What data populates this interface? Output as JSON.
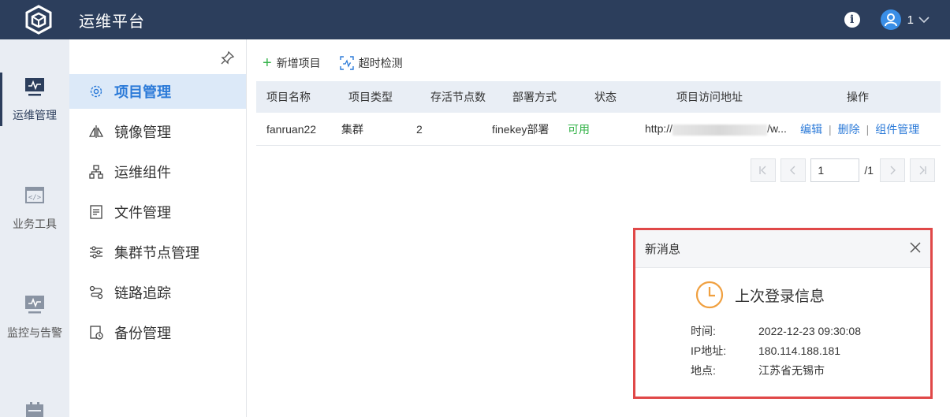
{
  "app": {
    "title": "运维平台",
    "user": "1"
  },
  "rail": [
    {
      "label": "运维管理",
      "icon": "monitor-chart-icon"
    },
    {
      "label": "业务工具",
      "icon": "code-window-icon"
    },
    {
      "label": "监控与告警",
      "icon": "monitor-alert-icon"
    },
    {
      "label": "",
      "icon": "calendar-icon"
    }
  ],
  "subnav": [
    {
      "label": "项目管理",
      "icon": "gear-icon"
    },
    {
      "label": "镜像管理",
      "icon": "mirror-icon"
    },
    {
      "label": "运维组件",
      "icon": "org-chart-icon"
    },
    {
      "label": "文件管理",
      "icon": "file-icon"
    },
    {
      "label": "集群节点管理",
      "icon": "sliders-icon"
    },
    {
      "label": "链路追踪",
      "icon": "trace-icon"
    },
    {
      "label": "备份管理",
      "icon": "backup-icon"
    }
  ],
  "toolbar": {
    "add_label": "新增项目",
    "timeout_label": "超时检测"
  },
  "table": {
    "headers": [
      "项目名称",
      "项目类型",
      "存活节点数",
      "部署方式",
      "状态",
      "项目访问地址",
      "操作"
    ],
    "rows": [
      {
        "name": "fanruan22",
        "type": "集群",
        "alive": "2",
        "deploy": "finekey部署",
        "status": "可用",
        "url_prefix": "http://",
        "url_suffix": "/w...",
        "actions": [
          "编辑",
          "删除",
          "组件管理"
        ]
      }
    ],
    "separator": "|"
  },
  "pager": {
    "current": "1",
    "total": "/1"
  },
  "notice": {
    "header": "新消息",
    "title": "上次登录信息",
    "fields": [
      {
        "k": "时间:",
        "v": "2022-12-23 09:30:08"
      },
      {
        "k": "IP地址:",
        "v": "180.114.188.181"
      },
      {
        "k": "地点:",
        "v": "江苏省无锡市"
      }
    ]
  },
  "colors": {
    "header": "#2c3e5c",
    "accent": "#2b7ad8",
    "success": "#35b34a",
    "alert_border": "#e04848"
  }
}
